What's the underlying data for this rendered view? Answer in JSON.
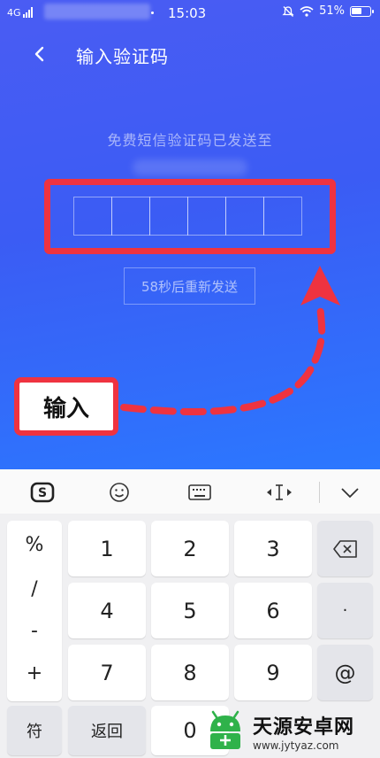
{
  "status_bar": {
    "network": "4G",
    "time": "15:03",
    "battery": "51%"
  },
  "header": {
    "title": "输入验证码"
  },
  "verification": {
    "sent_label": "免费短信验证码已发送至",
    "code_slots": [
      "",
      "",
      "",
      "",
      "",
      ""
    ],
    "resend_label": "58秒后重新发送"
  },
  "annotation": {
    "callout_text": "输入",
    "color": "#ef3340"
  },
  "keyboard": {
    "toolbar": [
      "sogou-logo-icon",
      "emoji-icon",
      "keyboard-icon",
      "cursor-icon",
      "collapse-icon"
    ],
    "symbols": [
      "%",
      "/",
      "-",
      "+"
    ],
    "digits": [
      "1",
      "2",
      "3",
      "4",
      "5",
      "6",
      "7",
      "8",
      "9",
      "0"
    ],
    "dot_key": "·",
    "at_key": "@",
    "fu_key": "符",
    "back_key": "返回"
  },
  "watermark": {
    "name": "天源安卓网",
    "url": "www.jytyaz.com"
  },
  "colors": {
    "background_top": "#4a5cf3",
    "background_bottom": "#2b78ff",
    "highlight": "#ef3340"
  }
}
